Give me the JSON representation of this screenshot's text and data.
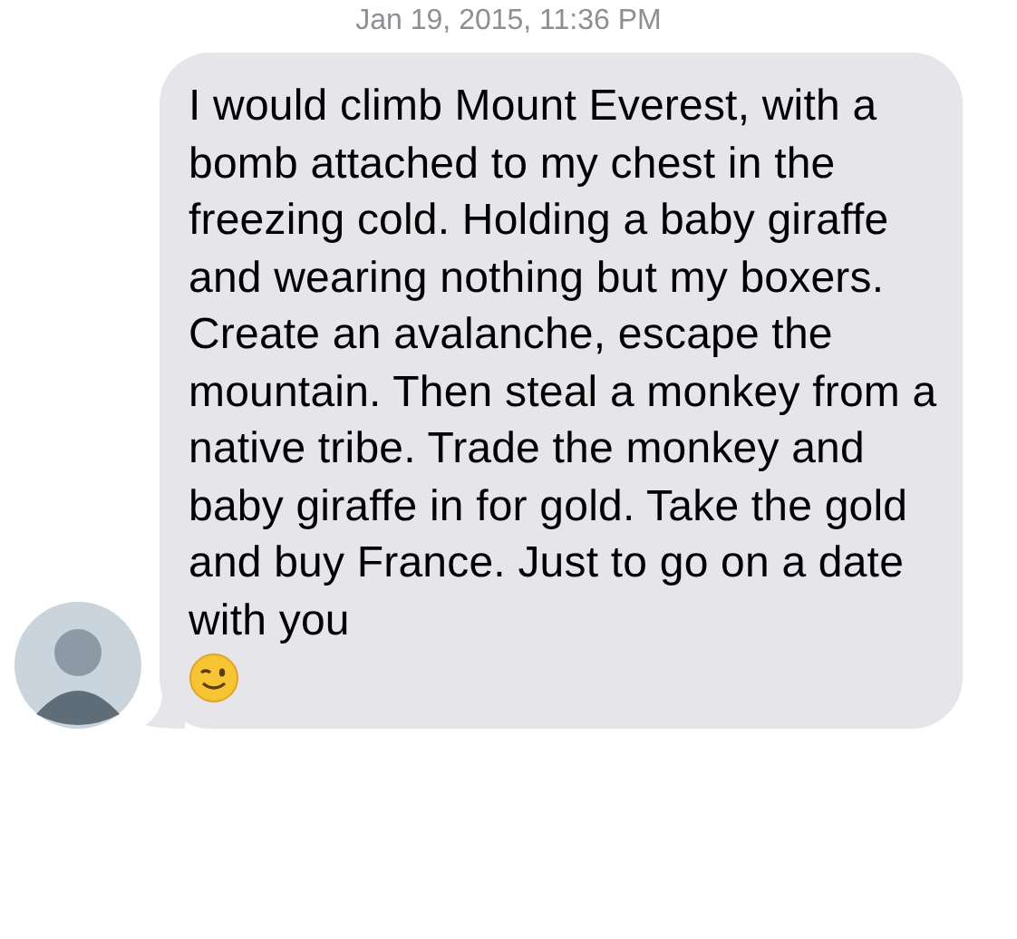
{
  "timestamp": "Jan 19, 2015, 11:36 PM",
  "message": {
    "text": "I would climb Mount Everest, with a bomb attached to my chest in the freezing cold. Holding a baby giraffe and wearing nothing but my boxers. Create an avalanche, escape the mountain. Then steal a monkey from a native tribe. Trade the monkey and baby giraffe in for gold. Take the gold and buy France. Just to go on a date with you"
  }
}
